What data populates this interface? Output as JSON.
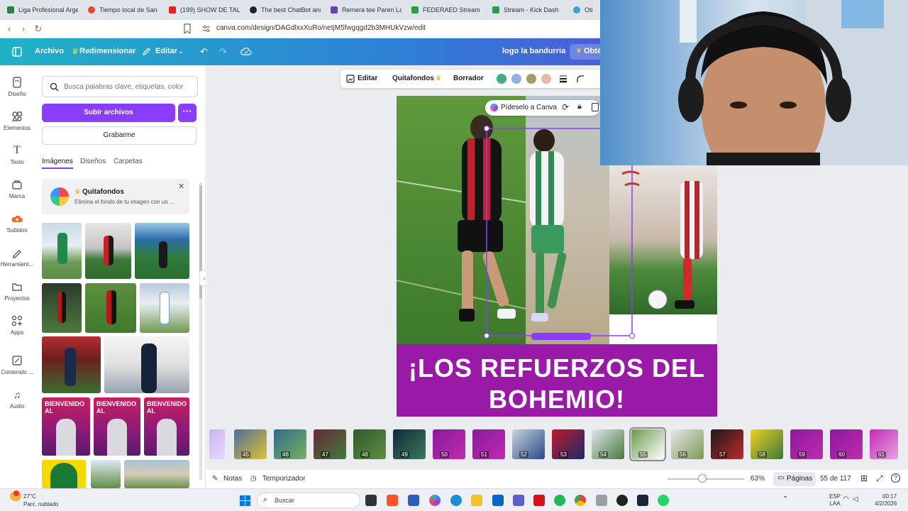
{
  "browser": {
    "tabs": [
      {
        "label": "Liga Profesional Argen",
        "color": "#2d7d46"
      },
      {
        "label": "Tiempo local de San J",
        "color": "#e34a2a"
      },
      {
        "label": "(199) SHOW DE TALEN",
        "color": "#e62117"
      },
      {
        "label": "The best ChatBot and",
        "color": "#222222"
      },
      {
        "label": "Remera tee Paren La M",
        "color": "#6a3fb5"
      },
      {
        "label": "FEDERAED Stream",
        "color": "#24a148"
      },
      {
        "label": "Stream - Kick Dash",
        "color": "#24a148"
      },
      {
        "label": "Oti",
        "color": "#3aa0d9"
      }
    ],
    "url": "canva.com/design/DAGdlxxXuRo/netjM5fwgqgd2b3MHUkVzw/edit"
  },
  "topbar": {
    "file": "Archivo",
    "resize": "Redimensionar",
    "edit": "Editar",
    "design_title": "logo la bandurria",
    "cta": "Obté"
  },
  "rail": [
    {
      "label": "Diseño"
    },
    {
      "label": "Elementos"
    },
    {
      "label": "Texto"
    },
    {
      "label": "Marca"
    },
    {
      "label": "Subidos"
    },
    {
      "label": "Herramient..."
    },
    {
      "label": "Proyectos"
    },
    {
      "label": "Apps"
    },
    {
      "label": "Contenido ..."
    },
    {
      "label": "Audio"
    }
  ],
  "panel": {
    "search_placeholder": "Busca palabras clave, etiquetas, color",
    "upload": "Subir archivos",
    "record": "Grabarme",
    "tabs": [
      "Imágenes",
      "Diseños",
      "Carpetas"
    ],
    "promo": {
      "title": "Quitafondos",
      "desc": "Elimina el fondo de tu imagen con un ..."
    },
    "thumb_labels": [
      "BIENVENIDO AL",
      "BIENVENIDO AL",
      "BIENVENIDO AL"
    ]
  },
  "context_toolbar": {
    "edit": "Editar",
    "bg_remove": "Quitafondos",
    "eraser": "Borrador",
    "swatches": [
      "#3fae7a",
      "#8fb3e6",
      "#a89a6a",
      "#e8b8a6"
    ]
  },
  "ask_canva": "Pídeselo a Canva",
  "design": {
    "headline": "¡LOS REFUERZOS DEL BOHEMIO!",
    "banner_colors": {
      "headline_bg": "#9a1aa8"
    }
  },
  "pages": {
    "numbers": [
      "45",
      "46",
      "47",
      "48",
      "49",
      "50",
      "51",
      "52",
      "53",
      "54",
      "55",
      "56",
      "57",
      "58",
      "59",
      "60",
      "61"
    ],
    "selected": "55"
  },
  "footer": {
    "notes": "Notas",
    "timer": "Temporizador",
    "zoom": "63%",
    "pages_label": "Páginas",
    "page_count": "55 de 117"
  },
  "taskbar": {
    "weather_temp": "27°C",
    "weather_desc": "Parc. nublado",
    "search": "Buscar",
    "lang_top": "ESP",
    "lang_bottom": "LAA",
    "time": "00:17",
    "date": "4/2/2026"
  }
}
